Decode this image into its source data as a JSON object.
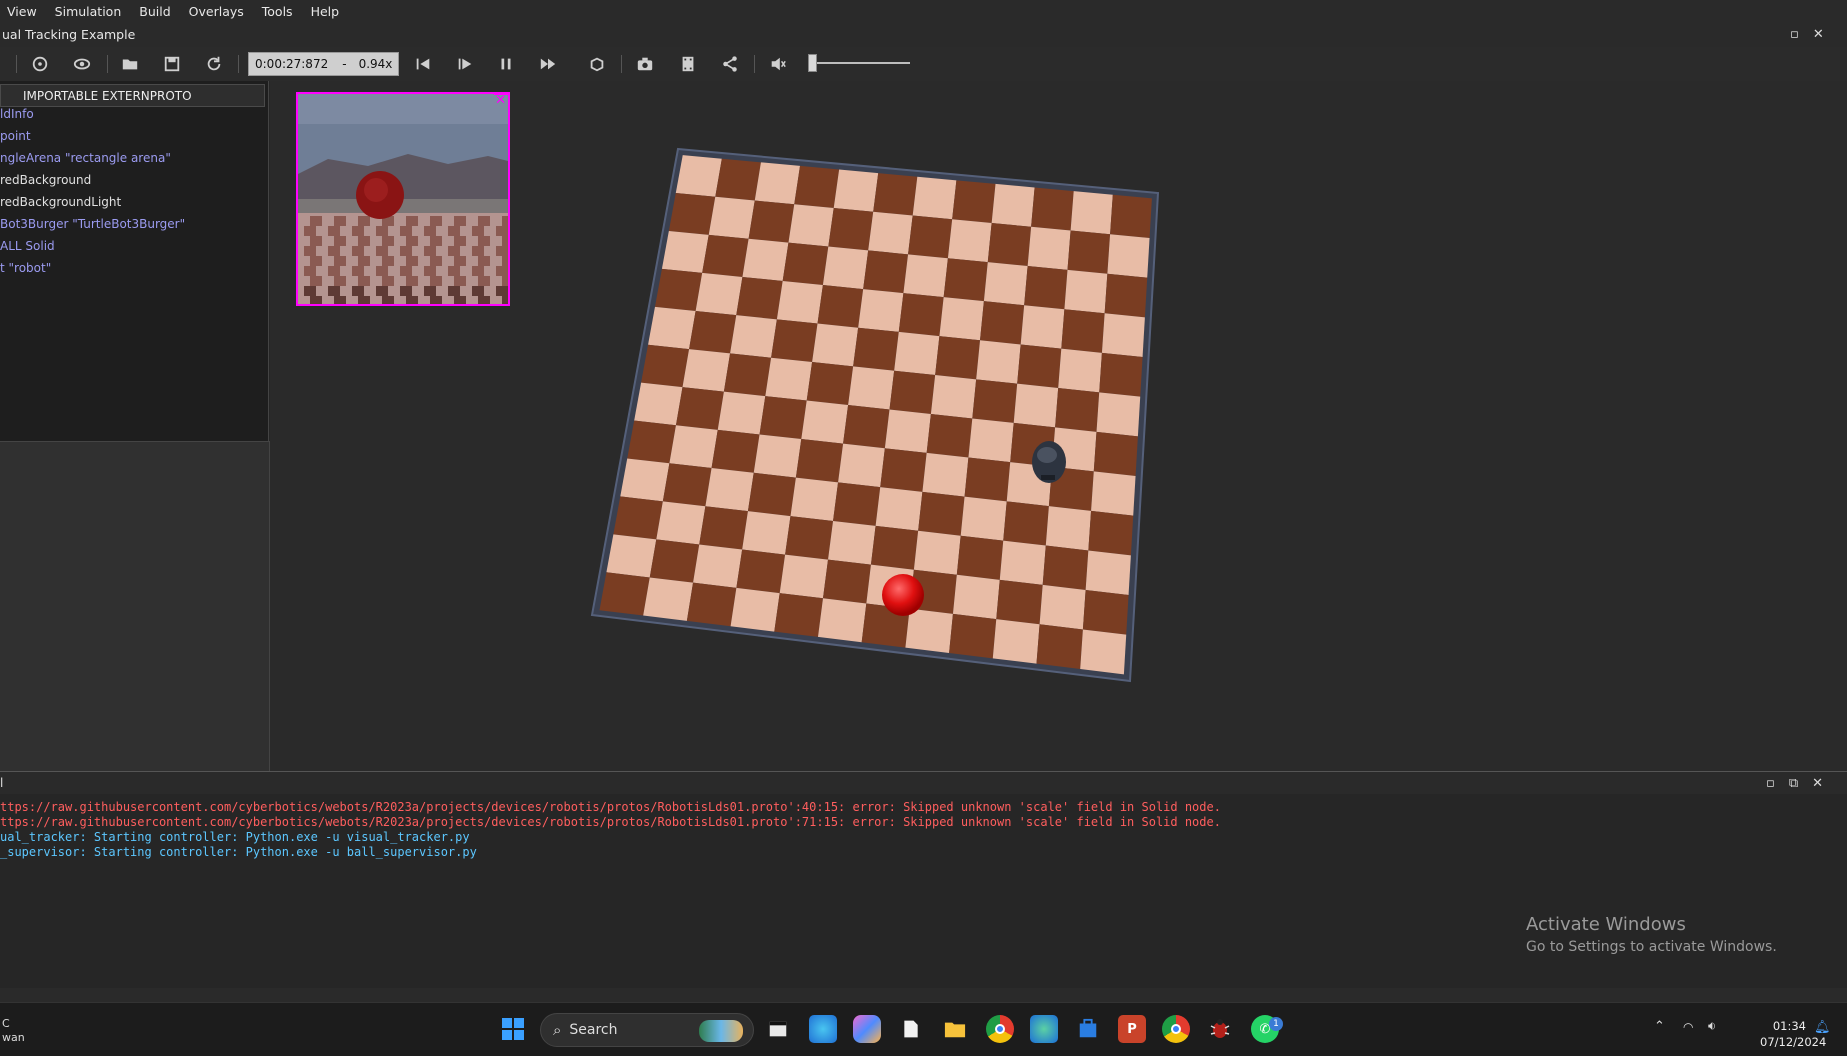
{
  "menu": [
    "View",
    "Simulation",
    "Build",
    "Overlays",
    "Tools",
    "Help"
  ],
  "window": {
    "title": "ual Tracking Example"
  },
  "toolbar": {
    "time": "0:00:27:872",
    "time_sep": "-",
    "speed": "0.94x"
  },
  "scene_tree": {
    "header": "IMPORTABLE EXTERNPROTO",
    "items": [
      {
        "label": "ldInfo",
        "color": "#9b9bf0"
      },
      {
        "label": "point",
        "color": "#9b9bf0"
      },
      {
        "label": "ngleArena \"rectangle arena\"",
        "color": "#9b9bf0"
      },
      {
        "label": "redBackground",
        "color": "#e0e0e0"
      },
      {
        "label": "redBackgroundLight",
        "color": "#e0e0e0"
      },
      {
        "label": "Bot3Burger \"TurtleBot3Burger\"",
        "color": "#9b9bf0"
      },
      {
        "label": "ALL Solid",
        "color": "#9b9bf0"
      },
      {
        "label": "t \"robot\"",
        "color": "#9b9bf0"
      }
    ]
  },
  "console": {
    "title": "l",
    "lines": [
      {
        "text": "ttps://raw.githubusercontent.com/cyberbotics/webots/R2023a/projects/devices/robotis/protos/RobotisLds01.proto':40:15: error: Skipped unknown 'scale' field in Solid node.",
        "kind": "err"
      },
      {
        "text": "ttps://raw.githubusercontent.com/cyberbotics/webots/R2023a/projects/devices/robotis/protos/RobotisLds01.proto':71:15: error: Skipped unknown 'scale' field in Solid node.",
        "kind": "err"
      },
      {
        "text": "ual_tracker: Starting controller: Python.exe -u visual_tracker.py",
        "kind": "info"
      },
      {
        "text": "_supervisor: Starting controller: Python.exe -u ball_supervisor.py",
        "kind": "info"
      }
    ]
  },
  "watermark": {
    "line1": "Activate Windows",
    "line2": "Go to Settings to activate Windows."
  },
  "taskbar": {
    "search_placeholder": "Search",
    "left_text_1": "C",
    "left_text_2": "wan",
    "clock_time": "01:34",
    "clock_date": "07/12/2024",
    "badge": "1",
    "apps": [
      "windows-start",
      "file-explorer-widget",
      "edge",
      "copilot",
      "notepad",
      "folder",
      "chrome",
      "edge-dev",
      "store",
      "powerpoint",
      "chrome-profile",
      "webots",
      "whatsapp"
    ]
  },
  "colors": {
    "error": "#ff5e5e",
    "info": "#5cc7ff",
    "ball": "#e01010",
    "selection": "#ff00ff"
  }
}
